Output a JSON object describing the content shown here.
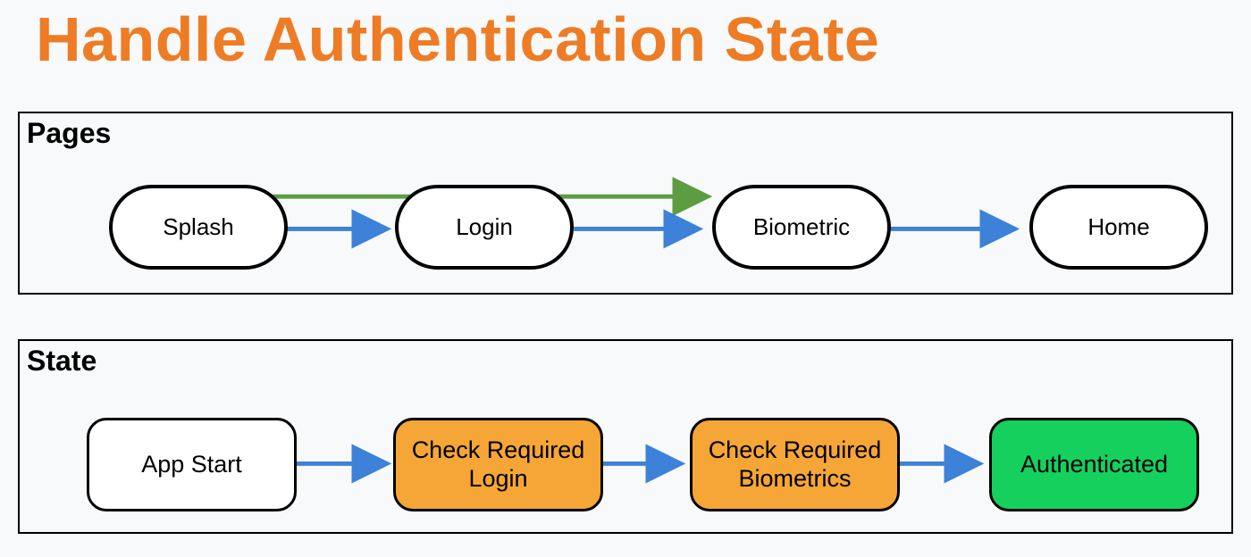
{
  "title": "Handle Authentication State",
  "colors": {
    "title": "#EE7C24",
    "arrow_blue": "#3D81D8",
    "arrow_green": "#5E9C42",
    "node_orange": "#F5A637",
    "node_green": "#16D05E"
  },
  "panels": {
    "pages": {
      "label": "Pages",
      "nodes": [
        {
          "id": "splash",
          "label": "Splash"
        },
        {
          "id": "login",
          "label": "Login"
        },
        {
          "id": "biometric",
          "label": "Biometric"
        },
        {
          "id": "home",
          "label": "Home"
        }
      ],
      "arrows": [
        {
          "from": "splash",
          "to": "login",
          "color": "blue"
        },
        {
          "from": "login",
          "to": "biometric",
          "color": "blue"
        },
        {
          "from": "biometric",
          "to": "home",
          "color": "blue"
        },
        {
          "from": "splash",
          "to": "biometric",
          "color": "green"
        }
      ]
    },
    "state": {
      "label": "State",
      "nodes": [
        {
          "id": "app-start",
          "label": "App Start",
          "style": "white"
        },
        {
          "id": "check-login",
          "label": "Check Required Login",
          "style": "orange"
        },
        {
          "id": "check-bio",
          "label": "Check Required Biometrics",
          "style": "orange"
        },
        {
          "id": "authenticated",
          "label": "Authenticated",
          "style": "green"
        }
      ],
      "arrows": [
        {
          "from": "app-start",
          "to": "check-login",
          "color": "blue"
        },
        {
          "from": "check-login",
          "to": "check-bio",
          "color": "blue"
        },
        {
          "from": "check-bio",
          "to": "authenticated",
          "color": "blue"
        }
      ]
    }
  }
}
